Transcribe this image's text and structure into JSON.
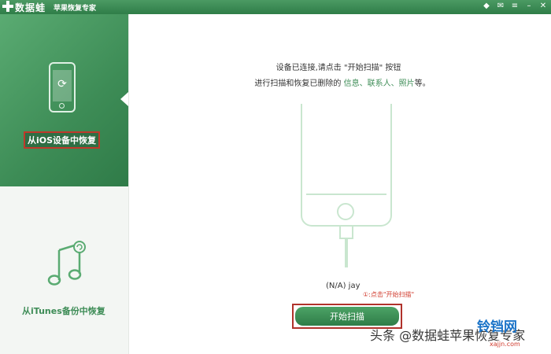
{
  "app": {
    "title": "数据蛙",
    "subtitle": "苹果恢复专家"
  },
  "titlebar_icons": [
    "diamond-icon",
    "message-icon",
    "menu-icon",
    "minimize-icon",
    "close-icon"
  ],
  "sidebar": {
    "items": [
      {
        "label": "从iOS设备中恢复",
        "icon": "phone-restore-icon",
        "active": true
      },
      {
        "label": "从iTunes备份中恢复",
        "icon": "music-note-icon",
        "active": false
      }
    ]
  },
  "main": {
    "message_line1": "设备已连接,请点击 \"开始扫描\" 按钮",
    "message_line2_prefix": "进行扫描和恢复已删除的 ",
    "message_line2_items": "信息、联系人、照片",
    "message_line2_suffix": "等。",
    "device_name": "(N/A) jay",
    "annotation": "①:点击\"开始扫描\"",
    "start_button": "开始扫描"
  },
  "watermark": {
    "text": "头条 @数据蛙苹果恢复专家",
    "logo": "铃铛网",
    "url": "xajjn.com"
  },
  "colors": {
    "brand_green": "#3d8c56",
    "highlight_red": "#c0392b"
  }
}
